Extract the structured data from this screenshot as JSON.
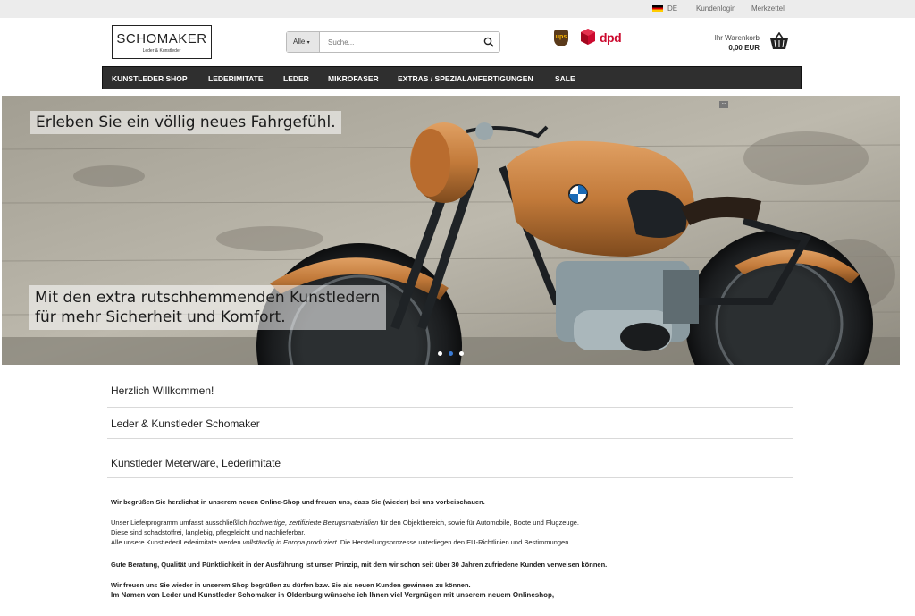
{
  "topbar": {
    "language": "DE",
    "account": "Kundenlogin",
    "wishlist": "Merkzettel"
  },
  "logo": {
    "name": "SCHOMAKER",
    "tagline": "Leder & Kunstleder"
  },
  "search": {
    "scope": "Alle",
    "placeholder": "Suche..."
  },
  "shipping": {
    "ups": "ups",
    "dpd": "dpd"
  },
  "cart": {
    "label": "Ihr Warenkorb",
    "total": "0,00 EUR"
  },
  "nav": {
    "items": [
      {
        "label": "KUNSTLEDER SHOP"
      },
      {
        "label": "LEDERIMITATE"
      },
      {
        "label": "LEDER"
      },
      {
        "label": "MIKROFASER"
      },
      {
        "label": "EXTRAS / SPEZIALANFERTIGUNGEN"
      },
      {
        "label": "SALE"
      }
    ],
    "more": "..."
  },
  "hero": {
    "caption_top": "Erleben Sie ein völlig neues Fahrgefühl.",
    "caption_bottom_line1": "Mit den extra rutschhemmenden Kunstledern",
    "caption_bottom_line2": "für mehr Sicherheit und Komfort.",
    "active_slide": 2,
    "slide_count": 3
  },
  "content": {
    "heading1": "Herzlich Willkommen!",
    "heading2": "Leder & Kunstleder Schomaker",
    "heading3": "Kunstleder Meterware, Lederimitate",
    "intro": "Wir begrüßen Sie herzlichst in unserem neuen Online-Shop und freuen uns, dass Sie (wieder) bei uns vorbeischauen.",
    "p1_a": "Unser Lieferprogramm umfasst ausschließlich ",
    "p1_em": "hochwertige, zertifizierte Bezugsmaterialien",
    "p1_b": " für den Objektbereich, sowie für Automobile, Boote und Flugzeuge.",
    "p1_line2": "Diese sind schadstoffrei, langlebig, pflegeleicht und nachlieferbar.",
    "p1_line3_a": "Alle unsere Kunstleder/Lederimitate werden ",
    "p1_line3_em": "vollständig in Europa produziert",
    "p1_line3_b": ". Die Herstellungsprozesse unterliegen den EU-Richtlinien und Bestimmungen.",
    "p2": "Gute Beratung, Qualität und Pünktlichkeit in der Ausführung ist unser Prinzip, mit dem wir schon seit über 30 Jahren zufriedene Kunden verweisen können.",
    "p3_line1": "Wir freuen uns Sie wieder in unserem Shop begrüßen zu dürfen bzw. Sie als neuen Kunden gewinnen zu können.",
    "p3_line2": "Im Namen von Leder und Kunstleder Schomaker in Oldenburg wünsche ich Ihnen viel Vergnügen mit unserem neuem Onlineshop,"
  },
  "colors": {
    "nav_bg": "#2f2f2f",
    "dpd_red": "#cc0a2f",
    "tank_copper": "#c27a3a"
  }
}
